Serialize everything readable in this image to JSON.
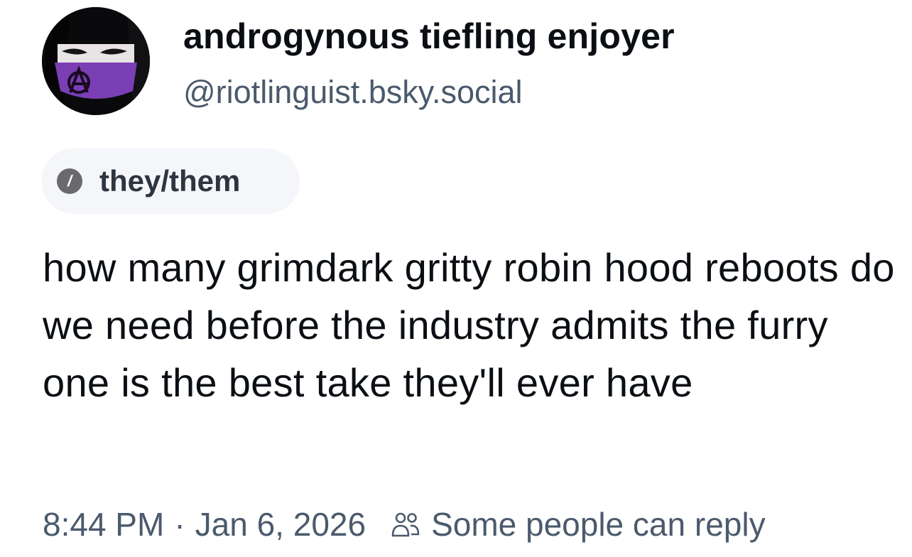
{
  "author": {
    "display_name": "androgynous tiefling enjoyer",
    "handle": "@riotlinguist.bsky.social",
    "avatar_icon": "avatar-masked-person-anarchy-icon"
  },
  "pronouns": {
    "icon": "info-icon",
    "icon_glyph": "/",
    "label": "they/them"
  },
  "post": {
    "text": "how many grimdark gritty robin hood reboots do we need before the industry admits the furry one is the best take they'll ever have"
  },
  "meta": {
    "time": "8:44 PM",
    "separator": "·",
    "date": "Jan 6, 2026",
    "reply_icon": "people-icon",
    "reply_setting": "Some people can reply"
  },
  "colors": {
    "text_primary": "#0b0f14",
    "text_secondary": "#4b5a6c",
    "pill_background": "#f4f6f9",
    "avatar_accent": "#7a3fb5"
  }
}
